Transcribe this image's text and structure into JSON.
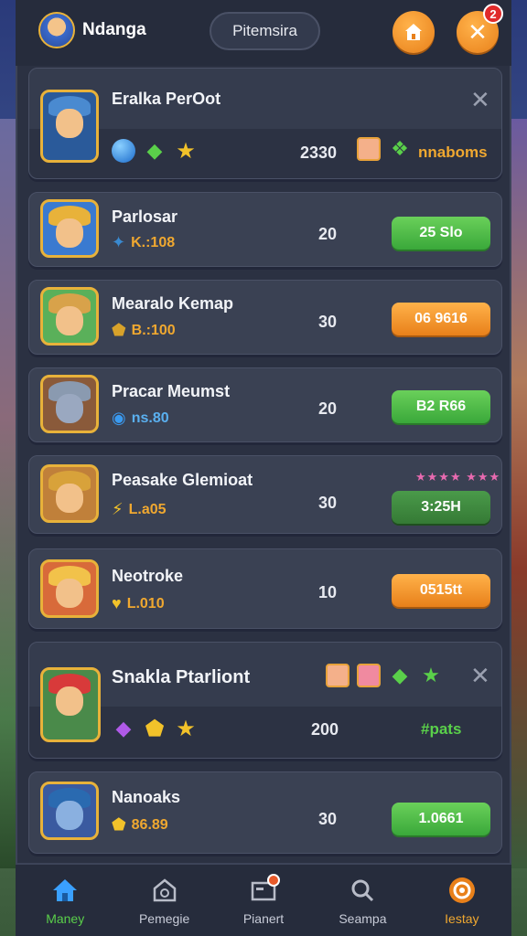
{
  "header": {
    "player_name": "Ndanga",
    "tab_label": "Pitemsira",
    "notification_count": "2"
  },
  "featured_top": {
    "name": "Eralka PerOot",
    "score": "2330",
    "reward_label": "nnaboms"
  },
  "rows": [
    {
      "name": "Parlosar",
      "sub": "K.:108",
      "score": "20",
      "action": "25 Slo",
      "style": "green"
    },
    {
      "name": "Mearalo Kemap",
      "sub": "B.:100",
      "score": "30",
      "action": "06 9616",
      "style": "orange"
    },
    {
      "name": "Pracar Meumst",
      "sub": "ns.80",
      "score": "20",
      "action": "B2 R66",
      "style": "green"
    },
    {
      "name": "Peasake Glemioat",
      "sub": "L.a05",
      "score": "30",
      "action": "3:25H",
      "style": "darkgreen"
    },
    {
      "name": "Neotroke",
      "sub": "L.010",
      "score": "10",
      "action": "0515tt",
      "style": "orange"
    }
  ],
  "featured_bottom": {
    "name": "Snakla Ptarliont",
    "score": "200",
    "reward_label": "#pats"
  },
  "last_row": {
    "name": "Nanoaks",
    "sub": "86.89",
    "score": "30",
    "action": "1.0661",
    "style": "green"
  },
  "nav": [
    {
      "label": "Maney",
      "icon": "home-icon"
    },
    {
      "label": "Pemegie",
      "icon": "building-icon"
    },
    {
      "label": "Pianert",
      "icon": "inbox-icon"
    },
    {
      "label": "Seampa",
      "icon": "search-icon"
    },
    {
      "label": "Iestay",
      "icon": "gear-icon"
    }
  ],
  "colors": {
    "panel": "#2b3142",
    "card": "#3a4153",
    "accent_orange": "#e8801a",
    "accent_green": "#3aa83a",
    "gold_text": "#f0a830"
  }
}
